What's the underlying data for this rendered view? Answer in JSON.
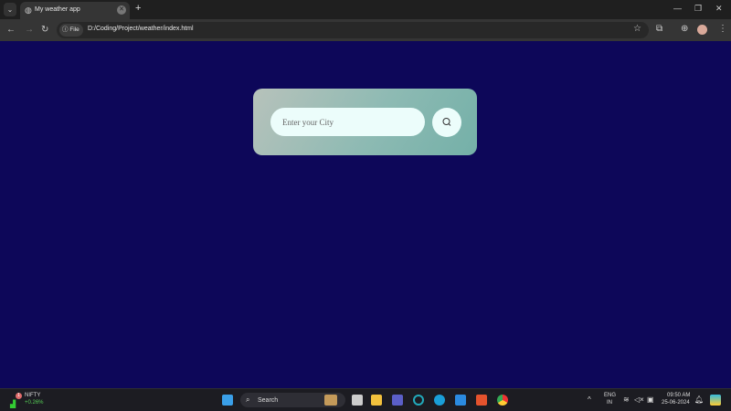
{
  "browser": {
    "tab_title": "My weather app",
    "url_chip": "File",
    "url": "D:/Coding/Project/weather/index.html"
  },
  "app": {
    "search_placeholder": "Enter your City",
    "colors": {
      "background": "#0d0759",
      "card_start": "#b7c2bb",
      "card_end": "#74b0a8",
      "input_bg": "#ecfdfb"
    }
  },
  "taskbar": {
    "widget_name": "NIFTY",
    "widget_value": "+0.26%",
    "widget_badge": "1",
    "search_label": "Search",
    "lang": "ENG",
    "region": "IN",
    "time": "09:50 AM",
    "date": "25-06-2024"
  }
}
